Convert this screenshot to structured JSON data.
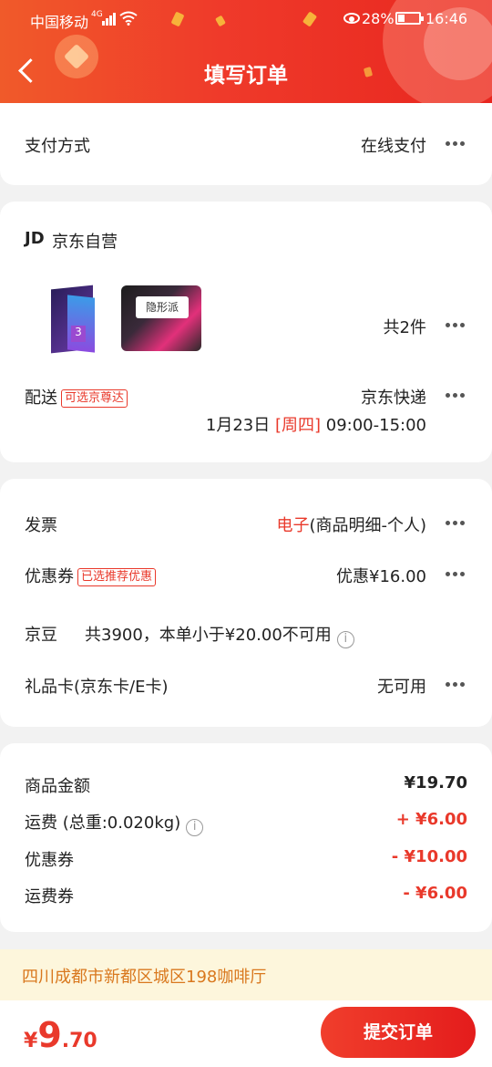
{
  "status_bar": {
    "carrier": "中国移动",
    "network": "4G",
    "battery": "28%",
    "time": "16:46"
  },
  "header": {
    "title": "填写订单"
  },
  "payment": {
    "label": "支付方式",
    "value": "在线支付"
  },
  "store": {
    "logo": "JD",
    "name": "京东自营",
    "product_count": "共2件",
    "product_images": [
      "kotex-u-product",
      "gaojiejie-yinxingpai-pads"
    ],
    "product2_text": "隐形派",
    "product1_badge": "3"
  },
  "delivery": {
    "label": "配送",
    "tag": "可选京尊达",
    "method": "京东快递",
    "date": "1月23日",
    "weekday": "[周四]",
    "time": "09:00-15:00"
  },
  "invoice": {
    "label": "发票",
    "type": "电子",
    "detail": "(商品明细-个人)"
  },
  "coupon": {
    "label": "优惠券",
    "tag": "已选推荐优惠",
    "value": "优惠¥16.00"
  },
  "jingdou": {
    "label": "京豆",
    "text": "共3900，本单小于¥20.00不可用",
    "info_icon": "i"
  },
  "giftcard": {
    "label": "礼品卡(京东卡/E卡)",
    "value": "无可用"
  },
  "summary": {
    "goods_label": "商品金额",
    "goods_value": "¥19.70",
    "freight_label": "运费 (总重:0.020kg)",
    "freight_value": "+ ¥6.00",
    "coupon_label": "优惠券",
    "coupon_value": "- ¥10.00",
    "freight_coupon_label": "运费券",
    "freight_coupon_value": "- ¥6.00",
    "info_icon": "i"
  },
  "address": "四川成都市新都区城区198咖啡厅",
  "footer": {
    "currency": "¥",
    "total_int": "9",
    "total_dec": ".70",
    "submit_label": "提交订单"
  },
  "colors": {
    "accent": "#e9392b",
    "header_start": "#f05a2a",
    "header_end": "#e8261f",
    "address_bg": "#fdf6dc"
  }
}
